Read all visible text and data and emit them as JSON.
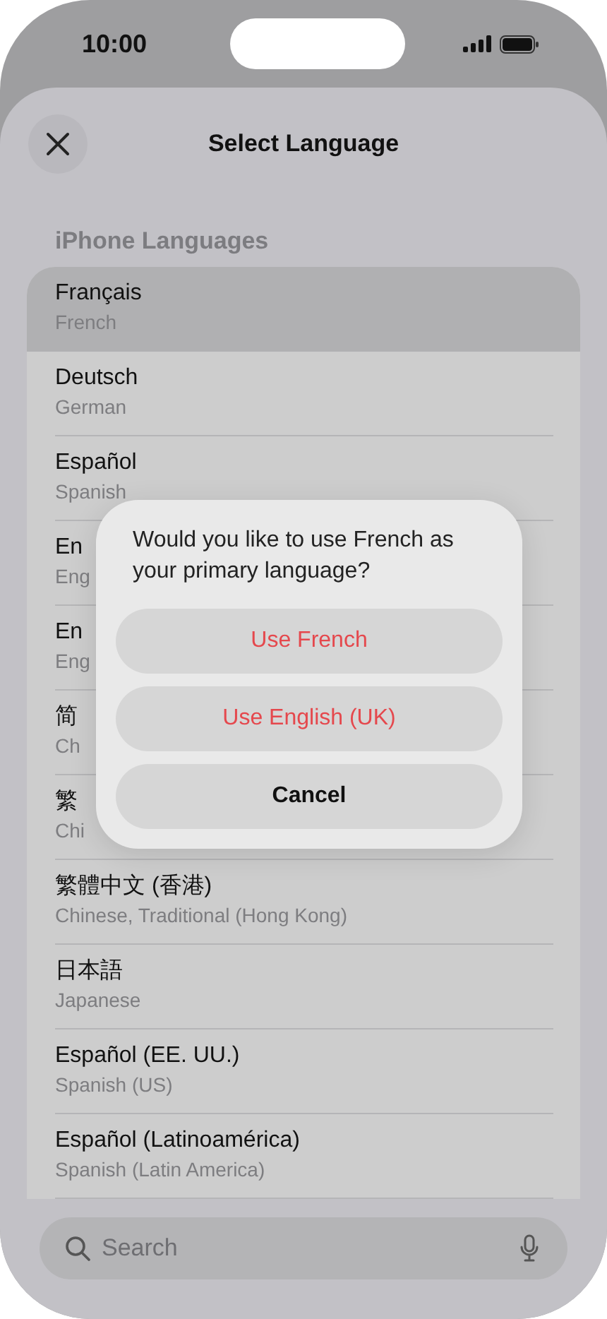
{
  "status_bar": {
    "time": "10:00"
  },
  "header": {
    "title": "Select Language"
  },
  "section": {
    "title": "iPhone Languages"
  },
  "languages": [
    {
      "name": "Français",
      "subtitle": "French",
      "selected": true
    },
    {
      "name": "Deutsch",
      "subtitle": "German",
      "selected": false
    },
    {
      "name": "Español",
      "subtitle": "Spanish",
      "selected": false
    },
    {
      "name": "En",
      "subtitle": "Eng",
      "selected": false
    },
    {
      "name": "En",
      "subtitle": "Eng",
      "selected": false
    },
    {
      "name": "简",
      "subtitle": "Ch",
      "selected": false
    },
    {
      "name": "繁",
      "subtitle": "Chi",
      "selected": false
    },
    {
      "name": "繁體中文 (香港)",
      "subtitle": "Chinese, Traditional (Hong Kong)",
      "selected": false
    },
    {
      "name": "日本語",
      "subtitle": "Japanese",
      "selected": false
    },
    {
      "name": "Español (EE. UU.)",
      "subtitle": "Spanish (US)",
      "selected": false
    },
    {
      "name": "Español (Latinoamérica)",
      "subtitle": "Spanish (Latin America)",
      "selected": false
    }
  ],
  "search": {
    "placeholder": "Search"
  },
  "dialog": {
    "message": "Would you like to use French as your primary language?",
    "buttons": [
      {
        "label": "Use French",
        "kind": "destructive"
      },
      {
        "label": "Use English (UK)",
        "kind": "destructive"
      },
      {
        "label": "Cancel",
        "kind": "cancel"
      }
    ]
  }
}
